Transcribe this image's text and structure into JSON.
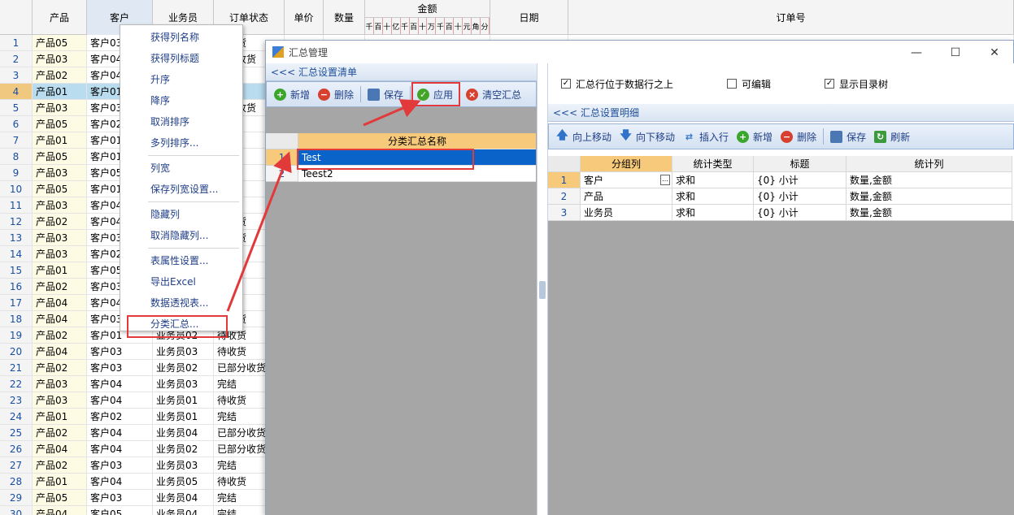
{
  "grid": {
    "columns": [
      "产品",
      "客户",
      "业务员",
      "订单状态",
      "单价",
      "数量",
      "金额",
      "日期",
      "订单号"
    ],
    "amount_digits": [
      "千",
      "百",
      "十",
      "亿",
      "千",
      "百",
      "十",
      "万",
      "千",
      "百",
      "十",
      "元",
      "角",
      "分"
    ],
    "rows": [
      [
        "1",
        "产品05",
        "客户03",
        "",
        "待收货"
      ],
      [
        "2",
        "产品03",
        "客户04",
        "",
        "部分收货"
      ],
      [
        "3",
        "产品02",
        "客户04",
        "",
        ""
      ],
      [
        "4",
        "产品01",
        "客户01",
        "",
        ""
      ],
      [
        "5",
        "产品03",
        "客户03",
        "",
        "部分收货"
      ],
      [
        "6",
        "产品05",
        "客户02",
        "",
        ""
      ],
      [
        "7",
        "产品01",
        "客户01",
        "",
        ""
      ],
      [
        "8",
        "产品05",
        "客户01",
        "",
        ""
      ],
      [
        "9",
        "产品03",
        "客户05",
        "",
        "货"
      ],
      [
        "10",
        "产品05",
        "客户01",
        "",
        ""
      ],
      [
        "11",
        "产品03",
        "客户04",
        "",
        ""
      ],
      [
        "12",
        "产品02",
        "客户04",
        "",
        "分收货"
      ],
      [
        "13",
        "产品03",
        "客户03",
        "",
        "分收货"
      ],
      [
        "14",
        "产品03",
        "客户02",
        "",
        ""
      ],
      [
        "15",
        "产品01",
        "客户05",
        "",
        ""
      ],
      [
        "16",
        "产品02",
        "客户03",
        "",
        "货"
      ],
      [
        "17",
        "产品04",
        "客户04",
        "",
        ""
      ],
      [
        "18",
        "产品04",
        "客户03",
        "",
        "分收货"
      ],
      [
        "19",
        "产品02",
        "客户01",
        "业务员02",
        "待收货"
      ],
      [
        "20",
        "产品04",
        "客户03",
        "业务员03",
        "待收货"
      ],
      [
        "21",
        "产品02",
        "客户03",
        "业务员02",
        "已部分收货"
      ],
      [
        "22",
        "产品03",
        "客户04",
        "业务员03",
        "完结"
      ],
      [
        "23",
        "产品03",
        "客户04",
        "业务员01",
        "待收货"
      ],
      [
        "24",
        "产品01",
        "客户02",
        "业务员01",
        "完结"
      ],
      [
        "25",
        "产品02",
        "客户04",
        "业务员04",
        "已部分收货"
      ],
      [
        "26",
        "产品04",
        "客户04",
        "业务员02",
        "已部分收货"
      ],
      [
        "27",
        "产品02",
        "客户03",
        "业务员03",
        "完结"
      ],
      [
        "28",
        "产品01",
        "客户04",
        "业务员05",
        "待收货"
      ],
      [
        "29",
        "产品05",
        "客户03",
        "业务员04",
        "完结"
      ],
      [
        "30",
        "产品04",
        "客户05",
        "业务员04",
        "完结"
      ]
    ]
  },
  "context_menu": {
    "items": [
      "获得列名称",
      "获得列标题",
      "升序",
      "降序",
      "取消排序",
      "多列排序...",
      "列宽",
      "保存列宽设置...",
      "隐藏列",
      "取消隐藏列...",
      "表属性设置...",
      "导出Excel",
      "数据透视表...",
      "分类汇总..."
    ]
  },
  "dialog": {
    "title": "汇总管理",
    "left": {
      "section_title": "<<< 汇总设置清单",
      "toolbar": {
        "add": "新增",
        "delete": "删除",
        "save": "保存",
        "apply": "应用",
        "clear": "清空汇总"
      },
      "grid_header": "分类汇总名称",
      "rows": [
        {
          "n": "1",
          "name": "Test"
        },
        {
          "n": "2",
          "name": "Teest2"
        }
      ]
    },
    "right": {
      "options": [
        {
          "label": "汇总行位于数据行之上",
          "checked": true
        },
        {
          "label": "可编辑",
          "checked": false
        },
        {
          "label": "显示目录树",
          "checked": true
        }
      ],
      "section_title": "<<< 汇总设置明细",
      "toolbar": {
        "up": "向上移动",
        "down": "向下移动",
        "insert": "插入行",
        "add": "新增",
        "delete": "删除",
        "save": "保存",
        "refresh": "刷新"
      },
      "grid_headers": [
        "分组列",
        "统计类型",
        "标题",
        "统计列"
      ],
      "rows": [
        {
          "n": "1",
          "group": "客户",
          "type": "求和",
          "title": "{0} 小计",
          "stat": "数量,金额"
        },
        {
          "n": "2",
          "group": "产品",
          "type": "求和",
          "title": "{0} 小计",
          "stat": "数量,金额"
        },
        {
          "n": "3",
          "group": "业务员",
          "type": "求和",
          "title": "{0} 小计",
          "stat": "数量,金额"
        }
      ]
    }
  },
  "colors": {
    "accent_orange": "#f7c97a",
    "selection_blue": "#0a63c8",
    "annotation_red": "#e23a3a"
  }
}
